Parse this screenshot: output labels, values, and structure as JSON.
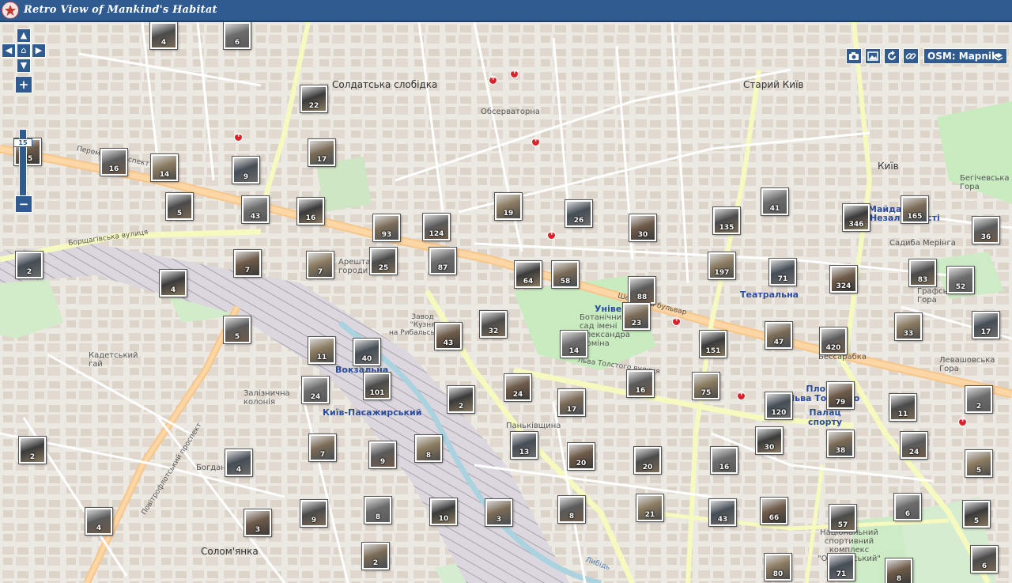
{
  "app": {
    "title": "Retro View of Mankind's Habitat"
  },
  "map": {
    "zoom": "15",
    "layer": "OSM: Mapnik",
    "labels": {
      "soldatska": "Солдатська\nслобідка",
      "observatorna": "Обсерваторна",
      "staryi_kyiv": "Старий Київ",
      "kyiv": "Київ",
      "maidan": "Майдан",
      "nezalezhnosti": "Незалежності",
      "sadyba": "Садиба Мерінга",
      "besarabka": "Бессарабка",
      "teatralna": "Театральна",
      "univer": "Універ",
      "botanic": "Ботанічний\nсад імені\nОлександра\nФоміна",
      "vokzalna": "Вокзальна",
      "kyiv_pas": "Київ-Пасажирський",
      "zaliznychna": "Залізнична\nколонія",
      "kadetskyi": "Кадетський\nгай",
      "pankivshchyna": "Паньківщина",
      "solomyanka": "Солом'янка",
      "zavod": "Завод\n\"Кузня\nна Рибальському\"",
      "arestantski": "Арештантські\nгороди",
      "ploshcha": "Площа\nЛьва Толстого",
      "palats": "Палац\nспорту",
      "levashovska": "Левашовська\nГора",
      "grafska": "Графська\nГора",
      "bechychevska": "Бегічевська\nГора",
      "natsionalnyi": "Національний\nспортивний\nкомплекс\n\"Олімпійський\"",
      "peremohy": "Перемоги проспект",
      "shevchenka": "Шевченка бульвар",
      "tolstoho": "Льва Толстого вулиця",
      "borschahivska": "Борщагівська вулиця",
      "povitroflotskyi": "Повітрофлотський проспект",
      "bohdane": "Богдана",
      "lybid": "Либідь"
    },
    "clusters": [
      "4",
      "6",
      "22",
      "17",
      "16",
      "14",
      "9",
      "35",
      "5",
      "43",
      "16",
      "93",
      "124",
      "19",
      "26",
      "30",
      "135",
      "41",
      "346",
      "165",
      "36",
      "7",
      "2",
      "7",
      "25",
      "87",
      "64",
      "58",
      "88",
      "197",
      "71",
      "324",
      "83",
      "52",
      "4",
      "23",
      "5",
      "11",
      "40",
      "43",
      "32",
      "14",
      "151",
      "47",
      "420",
      "33",
      "17",
      "24",
      "101",
      "24",
      "2",
      "17",
      "16",
      "75",
      "120",
      "79",
      "11",
      "2",
      "2",
      "7",
      "9",
      "8",
      "13",
      "20",
      "20",
      "16",
      "30",
      "38",
      "24",
      "5",
      "4",
      "3",
      "9",
      "8",
      "10",
      "3",
      "8",
      "21",
      "43",
      "66",
      "57",
      "6",
      "5",
      "2",
      "4",
      "80",
      "71",
      "8",
      "6"
    ]
  }
}
